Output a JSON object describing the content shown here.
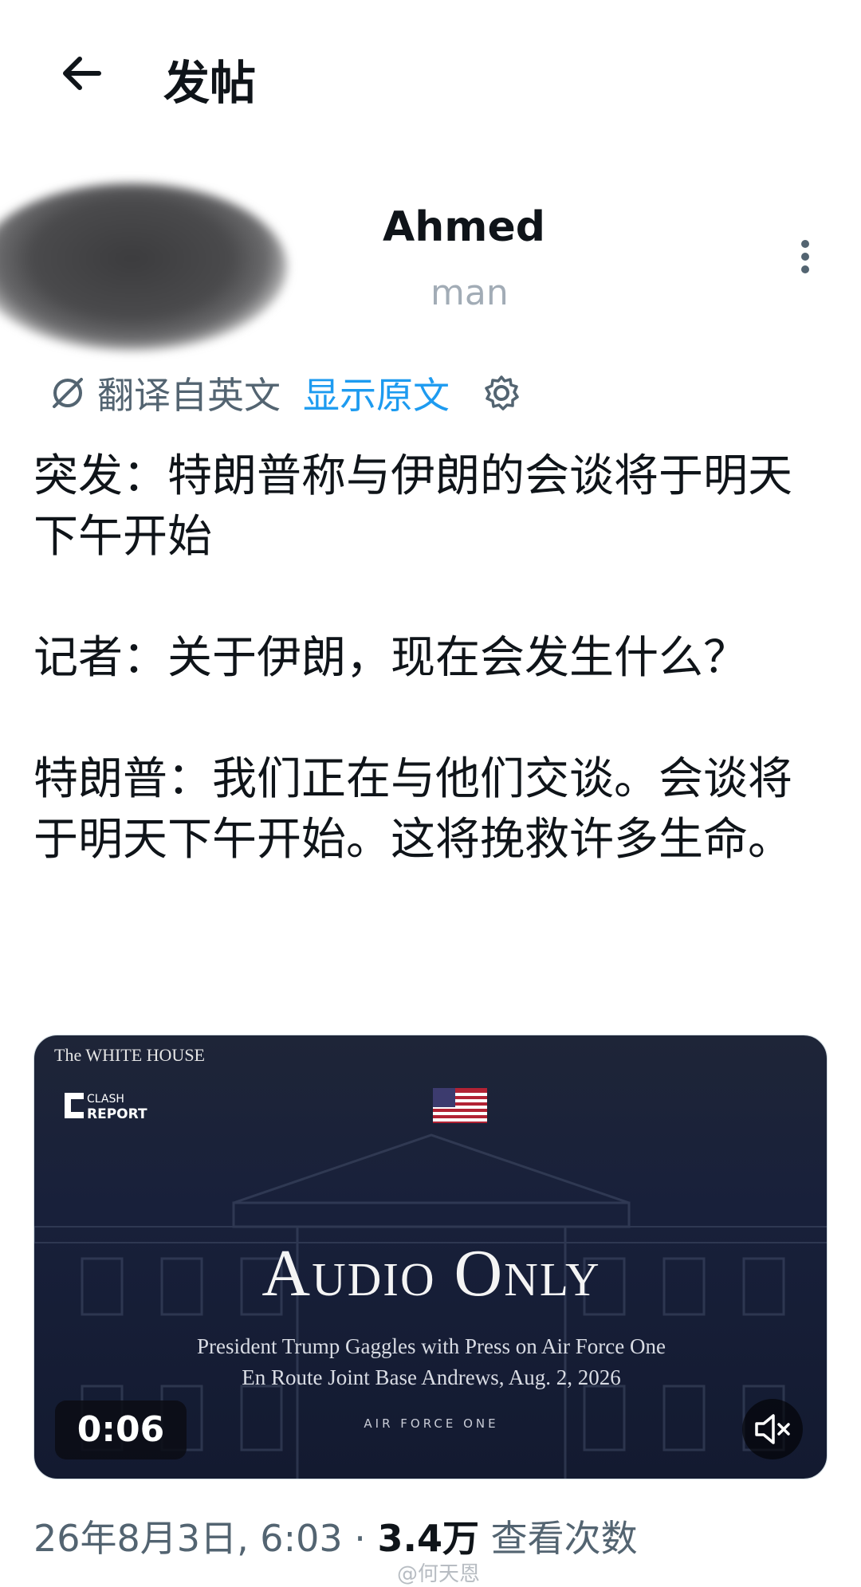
{
  "header": {
    "back_icon": "arrow-left-icon",
    "title": "发帖"
  },
  "author": {
    "name_visible": "Ahmed",
    "handle_visible": "man",
    "more_icon": "more-vertical-icon"
  },
  "translation": {
    "icon": "translate-icon",
    "from_label": "翻译自英文",
    "show_original": "显示原文",
    "settings_icon": "gear-icon"
  },
  "post": {
    "paragraphs": [
      "突发：特朗普称与伊朗的会谈将于明天下午开始",
      "记者：关于伊朗，现在会发生什么？",
      "特朗普：我们正在与他们交谈。会谈将于明天下午开始。这将挽救许多生命。"
    ]
  },
  "media": {
    "source_top": "The WHITE HOUSE",
    "clash_logo_top": "CLASH",
    "clash_logo_bottom": "REPORT",
    "headline": "Audio Only",
    "subtitle_line1": "President Trump Gaggles with Press on Air Force One",
    "subtitle_line2": "En Route Joint Base Andrews, Aug. 2, 2026",
    "caption": "AIR FORCE ONE",
    "duration": "0:06",
    "mute_icon": "volume-mute-icon"
  },
  "meta": {
    "datetime": "26年8月3日, 6:03",
    "separator": "·",
    "views_count": "3.4万",
    "views_label": "查看次数"
  },
  "watermark": "@何天恩"
}
